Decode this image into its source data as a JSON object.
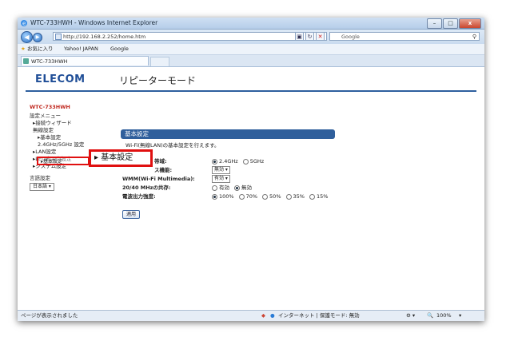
{
  "window": {
    "title": "WTC-733HWH - Windows Internet Explorer"
  },
  "address": {
    "url": "http://192.168.2.252/home.htm",
    "search_placeholder": "Google"
  },
  "favorites": {
    "label": "お気に入り",
    "links": [
      "Yahoo! JAPAN",
      "Google"
    ]
  },
  "tab": {
    "title": "WTC-733HWH"
  },
  "header": {
    "brand": "ELECOM",
    "mode": "リピーターモード"
  },
  "sidebar": {
    "device": "WTC-733HWH",
    "menu_title": "設定メニュー",
    "items": [
      "▸接続ウィザード",
      "無線設定",
      "▸基本設定",
      "2.4GHz/5GHz 設定",
      "▸LAN設定",
      "▸LED省電力設定",
      "▸システム設定"
    ],
    "lang_label": "言語設定",
    "lang_value": "日本語"
  },
  "main": {
    "section_title": "基本設定",
    "description": "Wi-Fi(無線LAN)の基本設定を行えます。",
    "rows": [
      {
        "label": "帯域:",
        "options": [
          "2.4GHz",
          "5GHz"
        ],
        "selected": 0
      },
      {
        "label": "ス機能:",
        "select": "無効"
      },
      {
        "label": "WMM(Wi-Fi Multimedia):",
        "select": "有効"
      },
      {
        "label": "20/40 MHzの共存:",
        "options": [
          "有効",
          "無効"
        ],
        "selected": 1
      },
      {
        "label": "電波出力強度:",
        "options": [
          "100%",
          "70%",
          "50%",
          "35%",
          "15%"
        ],
        "selected": 0
      }
    ],
    "apply_label": "適用"
  },
  "callout": {
    "small_label": "▸基本設定",
    "big_label": "▸ 基本設定"
  },
  "status": {
    "left": "ページが表示されました",
    "zone": "インターネット | 保護モード: 無効",
    "zoom": "100%"
  }
}
